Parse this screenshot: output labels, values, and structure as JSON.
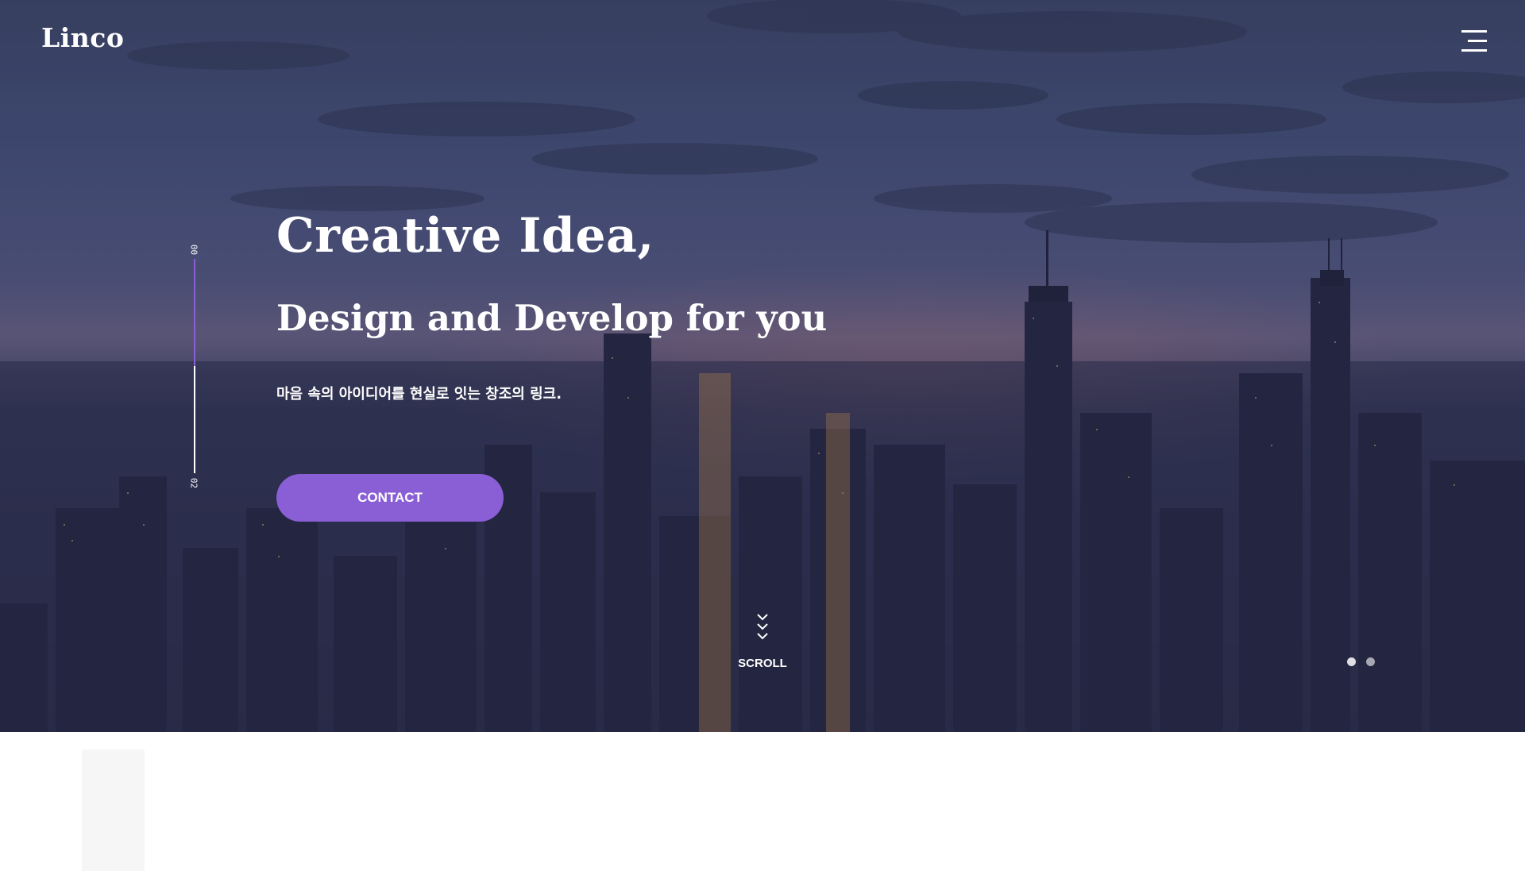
{
  "header": {
    "logo": "Linco",
    "menu_icon": "hamburger-menu-icon"
  },
  "hero": {
    "title_line1": "Creative Idea,",
    "title_line2": "Design and Develop for you",
    "subtitle": "마음 속의 아이디어를 현실로 잇는 창조의 링크.",
    "contact_label": "CONTACT",
    "scroll_label": "SCROLL",
    "scroll_icon": "triple-chevron-down-icon"
  },
  "slider": {
    "progress_start": "00",
    "progress_end": "02",
    "progress_fraction": 0.5,
    "dots": 2,
    "active_dot": 0
  },
  "colors": {
    "accent": "#8a5fd6",
    "text": "#ffffff",
    "sky": "#46527a"
  }
}
